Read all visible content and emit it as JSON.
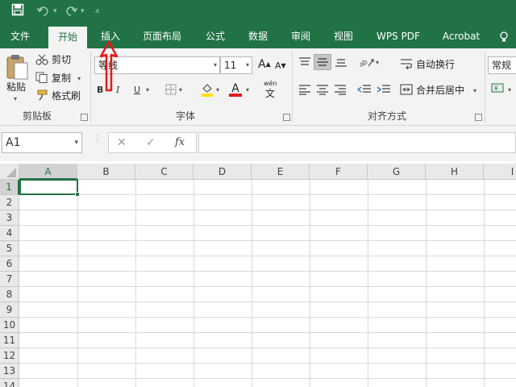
{
  "quick_access": {
    "save_icon": "save-icon",
    "undo_icon": "undo-icon",
    "redo_icon": "redo-icon",
    "customize_icon": "customize-icon"
  },
  "tabs": [
    {
      "label": "文件"
    },
    {
      "label": "开始"
    },
    {
      "label": "插入"
    },
    {
      "label": "页面布局"
    },
    {
      "label": "公式"
    },
    {
      "label": "数据"
    },
    {
      "label": "审阅"
    },
    {
      "label": "视图"
    },
    {
      "label": "WPS PDF"
    },
    {
      "label": "Acrobat"
    }
  ],
  "active_tab": "开始",
  "clipboard": {
    "paste_label": "粘贴",
    "cut_label": "剪切",
    "copy_label": "复制",
    "format_painter_label": "格式刷",
    "group_label": "剪贴板"
  },
  "font": {
    "font_name": "等线",
    "font_size": "11",
    "grow_label": "A",
    "shrink_label": "A",
    "bold_label": "B",
    "italic_label": "I",
    "underline_label": "U",
    "color_label": "A",
    "phonetic_label": "wén",
    "phonetic_char": "文",
    "group_label": "字体"
  },
  "alignment": {
    "wrap_text_label": "自动换行",
    "merge_center_label": "合并后居中",
    "group_label": "对齐方式"
  },
  "number": {
    "format_value": "常规"
  },
  "formula_bar": {
    "name_box_value": "A1",
    "cancel_label": "✕",
    "enter_label": "✓",
    "fx_label": "fx",
    "formula_value": ""
  },
  "sheet": {
    "columns": [
      "A",
      "B",
      "C",
      "D",
      "E",
      "F",
      "G",
      "H",
      "I"
    ],
    "rows": [
      "1",
      "2",
      "3",
      "4",
      "5",
      "6",
      "7",
      "8",
      "9",
      "10",
      "11",
      "12",
      "13",
      "14"
    ],
    "selected_cell": "A1"
  },
  "colors": {
    "brand_green": "#217346",
    "annotation_red": "#e8181b"
  }
}
